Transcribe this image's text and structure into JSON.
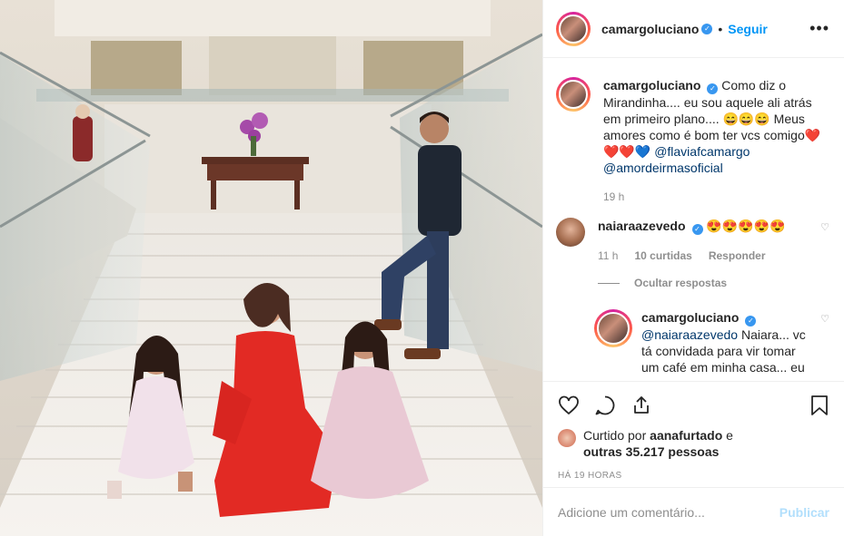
{
  "post": {
    "username": "camargoluciano",
    "follow_label": "Seguir",
    "more_label": "•••"
  },
  "caption": {
    "username": "camargoluciano",
    "text": "Como diz o Mirandinha.... eu sou aquele ali atrás em primeiro plano.... 😄😄😄 Meus amores como é bom ter vcs comigo❤️❤️❤️💙",
    "mentions": [
      "@flaviafcamargo",
      "@amordeirmasoficial"
    ],
    "time": "19 h"
  },
  "comment": {
    "username": "naiaraazevedo",
    "text": "😍😍😍😍😍",
    "time": "11 h",
    "likes": "10 curtidas",
    "reply_label": "Responder",
    "hide_replies": "Ocultar respostas"
  },
  "reply": {
    "username": "camargoluciano",
    "mention": "@naiaraazevedo",
    "text": "Naiara... vc tá convidada para vir tomar um café em minha casa... eu"
  },
  "likes": {
    "prefix": "Curtido por",
    "user": "aanafurtado",
    "conj": "e",
    "others": "outras 35.217 pessoas"
  },
  "date_label": "HÁ 19 HORAS",
  "comment_input": {
    "placeholder": "Adicione um comentário...",
    "publish_label": "Publicar"
  },
  "colors": {
    "accent": "#0095f6",
    "verified": "#3897f0",
    "muted": "#8e8e8e",
    "publish_disabled": "#b2dffc"
  }
}
